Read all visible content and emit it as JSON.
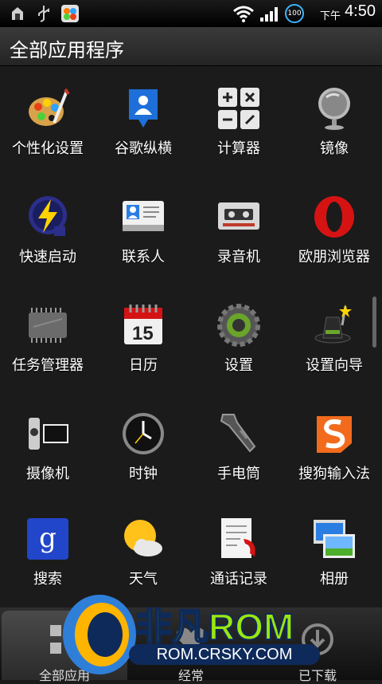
{
  "status_bar": {
    "time_period": "下午",
    "time": "4:50",
    "battery": "100",
    "icons": [
      "debug-icon",
      "usb-icon",
      "notification-icon",
      "wifi-icon",
      "signal-icon",
      "battery-icon"
    ]
  },
  "title": "全部应用程序",
  "apps": [
    {
      "label": "个性化设置",
      "icon": "palette-icon"
    },
    {
      "label": "谷歌纵横",
      "icon": "latitude-icon"
    },
    {
      "label": "计算器",
      "icon": "calculator-icon"
    },
    {
      "label": "镜像",
      "icon": "mirror-icon"
    },
    {
      "label": "快速启动",
      "icon": "lightning-icon"
    },
    {
      "label": "联系人",
      "icon": "contacts-card-icon"
    },
    {
      "label": "录音机",
      "icon": "cassette-icon"
    },
    {
      "label": "欧朋浏览器",
      "icon": "opera-icon"
    },
    {
      "label": "任务管理器",
      "icon": "chip-icon"
    },
    {
      "label": "日历",
      "icon": "calendar-icon"
    },
    {
      "label": "设置",
      "icon": "gear-icon"
    },
    {
      "label": "设置向导",
      "icon": "wizard-hat-icon"
    },
    {
      "label": "摄像机",
      "icon": "camcorder-icon"
    },
    {
      "label": "时钟",
      "icon": "clock-icon"
    },
    {
      "label": "手电筒",
      "icon": "flashlight-icon"
    },
    {
      "label": "搜狗输入法",
      "icon": "sogou-icon"
    },
    {
      "label": "搜索",
      "icon": "google-search-icon"
    },
    {
      "label": "天气",
      "icon": "weather-icon"
    },
    {
      "label": "通话记录",
      "icon": "call-log-icon"
    },
    {
      "label": "相册",
      "icon": "gallery-icon"
    }
  ],
  "calendar_day": "15",
  "bottom_tabs": [
    {
      "label": "全部应用"
    },
    {
      "label": "经常"
    },
    {
      "label": "已下载"
    }
  ],
  "watermark": {
    "brand": "非凡ROM",
    "url": "ROM.CRSKY.COM"
  },
  "colors": {
    "background": "#1b1b1b",
    "title_bar": "#2f2f2f",
    "text": "#ffffff"
  }
}
